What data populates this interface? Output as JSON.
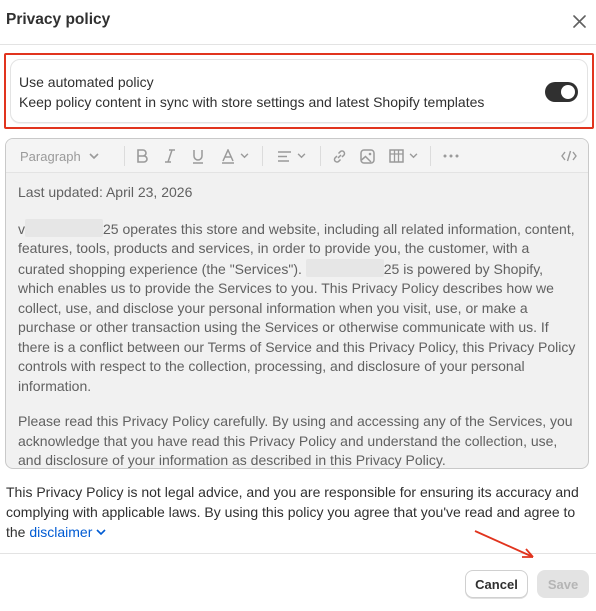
{
  "modal": {
    "title": "Privacy policy"
  },
  "automated_policy": {
    "title": "Use automated policy",
    "description": "Keep policy content in sync with store settings and latest Shopify templates",
    "enabled": true
  },
  "toolbar": {
    "block_format": "Paragraph",
    "icons": [
      "bold-icon",
      "italic-icon",
      "underline-icon",
      "text-color-icon",
      "align-icon",
      "link-icon",
      "image-icon",
      "table-icon",
      "more-icon",
      "code-icon"
    ]
  },
  "editor": {
    "last_updated": "Last updated: April 23, 2026",
    "p1_start": "v",
    "p1_a": "25 operates this store and website, including all related information, content, features, tools, products and services, in order to provide you, the customer, with a curated shopping experience (the \"Services\"). ",
    "p1_b": "25 is powered by Shopify, which enables us to provide the Services to you. This Privacy Policy describes how we collect, use, and disclose your personal information when you visit, use, or make a purchase or other transaction using the Services or otherwise communicate with us. If there is a conflict between our Terms of Service and this Privacy Policy, this Privacy Policy controls with respect to the collection, processing, and disclosure of your personal information.",
    "p2": "Please read this Privacy Policy carefully. By using and accessing any of the Services, you acknowledge that you have read this Privacy Policy and understand the collection, use, and disclosure of your information as described in this Privacy Policy."
  },
  "disclaimer": {
    "text": "This Privacy Policy is not legal advice, and you are responsible for ensuring its accuracy and complying with applicable laws. By using this policy you agree that you've read and agree to the ",
    "link": "disclaimer"
  },
  "footer": {
    "cancel_label": "Cancel",
    "save_label": "Save"
  },
  "colors": {
    "highlight": "#e1341e",
    "toggle_on": "#303030",
    "link": "#005bd3"
  }
}
